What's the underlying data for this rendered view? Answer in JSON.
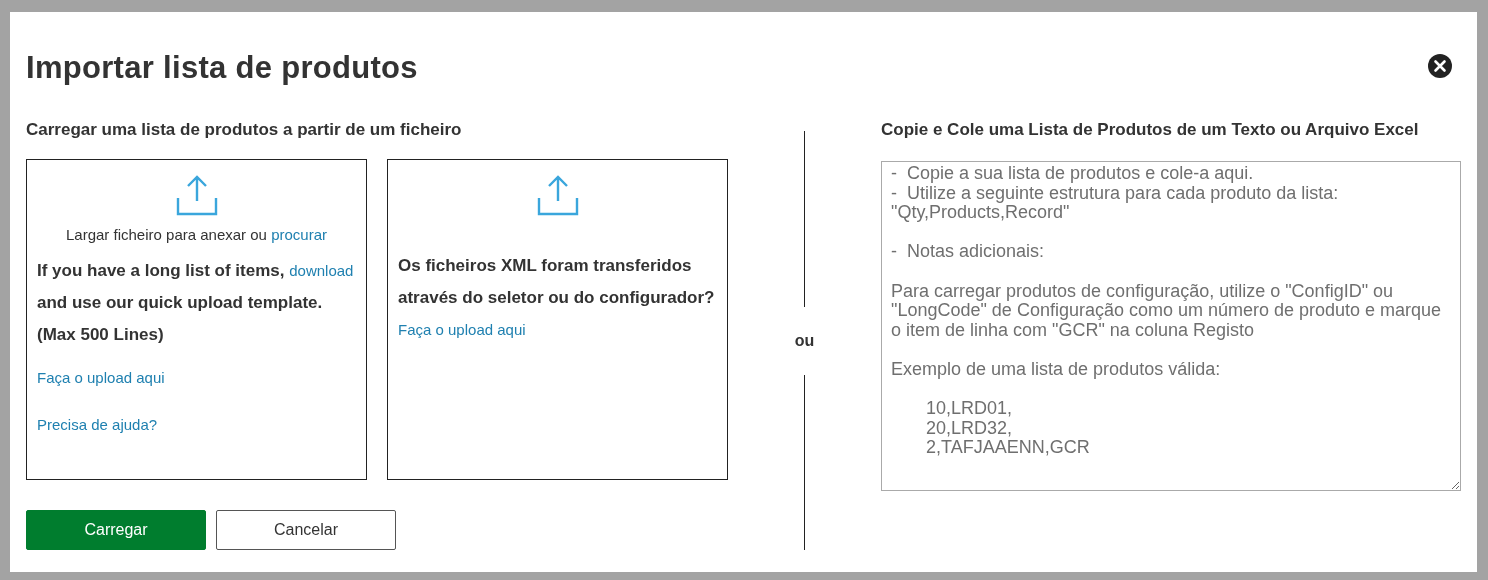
{
  "dialog": {
    "title": "Importar lista de produtos",
    "file_section": {
      "heading": "Carregar uma lista de produtos a partir de um ficheiro",
      "cards": [
        {
          "drop_text": [
            {
              "kind": "text",
              "text": "Largar ficheiro para anexar ou "
            },
            {
              "kind": "link",
              "text": "procurar"
            }
          ],
          "description": [
            {
              "kind": "text",
              "text": "If you have a long list of items, "
            },
            {
              "kind": "link",
              "text": "download"
            },
            {
              "kind": "text",
              "text": " and use our quick upload template. (Max 500 Lines)"
            }
          ],
          "links": [
            "Faça o upload aqui",
            "Precisa de ajuda?"
          ]
        },
        {
          "description": [
            {
              "kind": "text",
              "text": "Os ficheiros XML foram transferidos através do seletor ou do configurador? "
            },
            {
              "kind": "link",
              "text": "Faça o upload aqui"
            }
          ]
        }
      ]
    },
    "separator": "ou",
    "paste_section": {
      "heading": "Copie e Cole uma Lista de Produtos de um Texto ou Arquivo Excel",
      "placeholder": "-  Copie a sua lista de produtos e cole-a aqui.\n-  Utilize a seguinte estrutura para cada produto da lista: \"Qty,Products,Record\"\n\n-  Notas adicionais:\n\nPara carregar produtos de configuração, utilize o \"ConfigID\" ou \"LongCode\" de Configuração como um número de produto e marque o item de linha com \"GCR\" na coluna Registo\n\nExemplo de uma lista de produtos válida:\n\n       10,LRD01,\n       20,LRD32,\n       2,TAFJAAENN,GCR"
    },
    "buttons": [
      {
        "label": "Carregar",
        "kind": "primary"
      },
      {
        "label": "Cancelar",
        "kind": "secondary"
      }
    ]
  }
}
